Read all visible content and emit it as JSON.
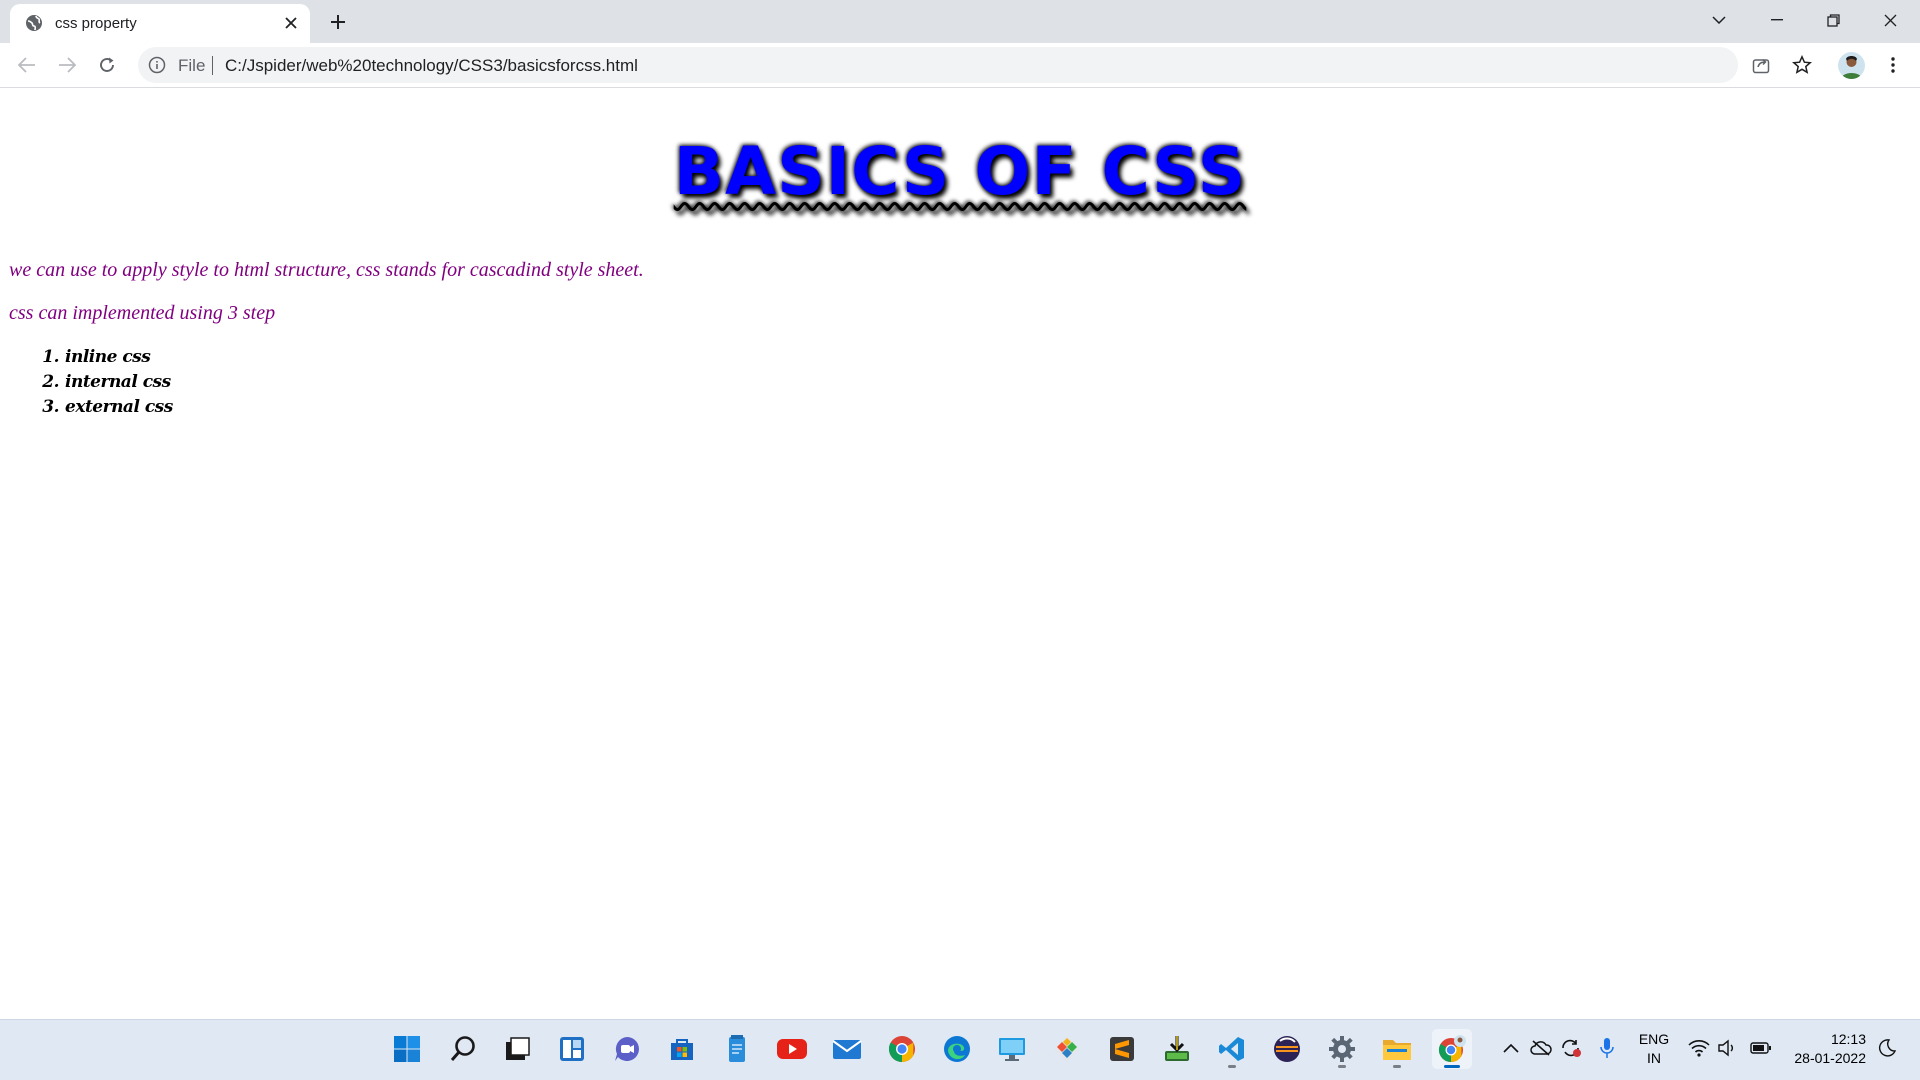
{
  "browser": {
    "tab_title": "css property",
    "url_scheme_label": "File",
    "url": "C:/Jspider/web%20technology/CSS3/basicsforcss.html"
  },
  "page": {
    "heading": "BASICS OF CSS",
    "paragraph1": "we can use to apply style to html structure, css stands for cascadind style sheet.",
    "paragraph2": "css can implemented using 3 step",
    "steps": [
      {
        "num": "1.",
        "label": "inline css"
      },
      {
        "num": "2.",
        "label": "internal css"
      },
      {
        "num": "3.",
        "label": "external css"
      }
    ]
  },
  "taskbar": {
    "apps": [
      "start",
      "search",
      "task-view",
      "widgets",
      "teams-chat",
      "microsoft-store",
      "notepad",
      "youtube",
      "mail",
      "chrome",
      "edge",
      "remote-desktop",
      "git",
      "sublime-text",
      "installer",
      "vs-code",
      "eclipse",
      "settings",
      "file-explorer",
      "chrome-profile"
    ],
    "language_top": "ENG",
    "language_bottom": "IN",
    "time": "12:13",
    "date": "28-01-2022"
  },
  "colors": {
    "heading": "#0000ff",
    "paragraph": "#800080",
    "list": "#000000"
  }
}
